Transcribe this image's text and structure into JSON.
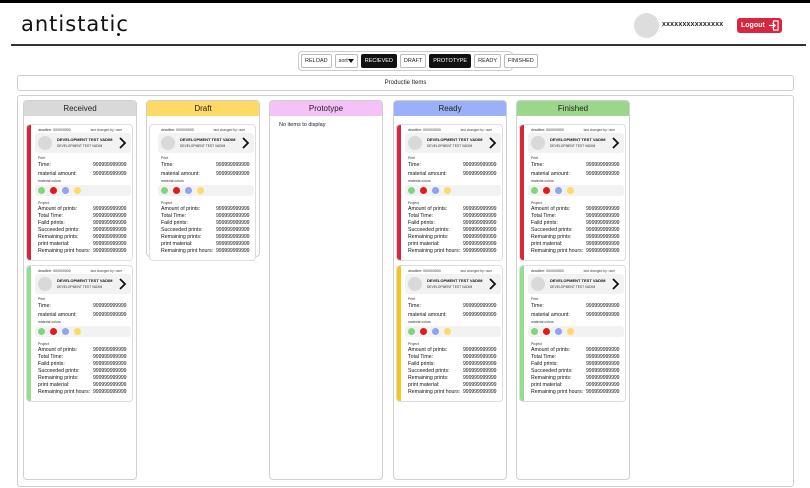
{
  "header": {
    "logo": "antistatic",
    "username": "xxxxxxxxxxxxxxx",
    "logout_label": "Logout"
  },
  "filters": {
    "reload": "RELOAD",
    "sort": "sort",
    "recieved": "RECIEVED",
    "draft": "DRAFT",
    "prototype": "PROTOTYPE",
    "ready": "READY",
    "finished": "FINISHED"
  },
  "title": "Productie Items",
  "columns": [
    {
      "title": "Received",
      "color": "#d9d9d9"
    },
    {
      "title": "Draft",
      "color": "#ffd966"
    },
    {
      "title": "Prototype",
      "color": "#f4c2f7",
      "empty_text": "No items to display"
    },
    {
      "title": "Ready",
      "color": "#9bb0f7"
    },
    {
      "title": "Finished",
      "color": "#9bd68a"
    }
  ],
  "card_labels": {
    "deadline": "deadline: 00/00/0000",
    "changed": "last changed by: user",
    "title": "DEVELOPMENT TEST VADIM",
    "subtitle": "DEVELOPMENT TEST VADIM",
    "print_section": "Print",
    "time": "Time:",
    "material_amount": "material amount:",
    "material_colors": "material colors",
    "project_section": "Project",
    "amount_of_prints": "Amount of prints:",
    "total_time": "Total Time:",
    "faild_prints": "Faild prints:",
    "succeeded_prints": "Succeeded prints:",
    "remaining_prints": "Remaining prints:",
    "print_material": "print material:",
    "remaining_print_hours": "Remaining print hours:",
    "value": "999999999999"
  },
  "colors": {
    "strip_red": "#d7263d",
    "strip_green": "#90e090",
    "strip_yellow": "#f5c518",
    "dot_green": "#7fd67f",
    "dot_red": "#e01b1b",
    "dot_blue": "#8fa3f0",
    "dot_yellow": "#ffd966"
  }
}
